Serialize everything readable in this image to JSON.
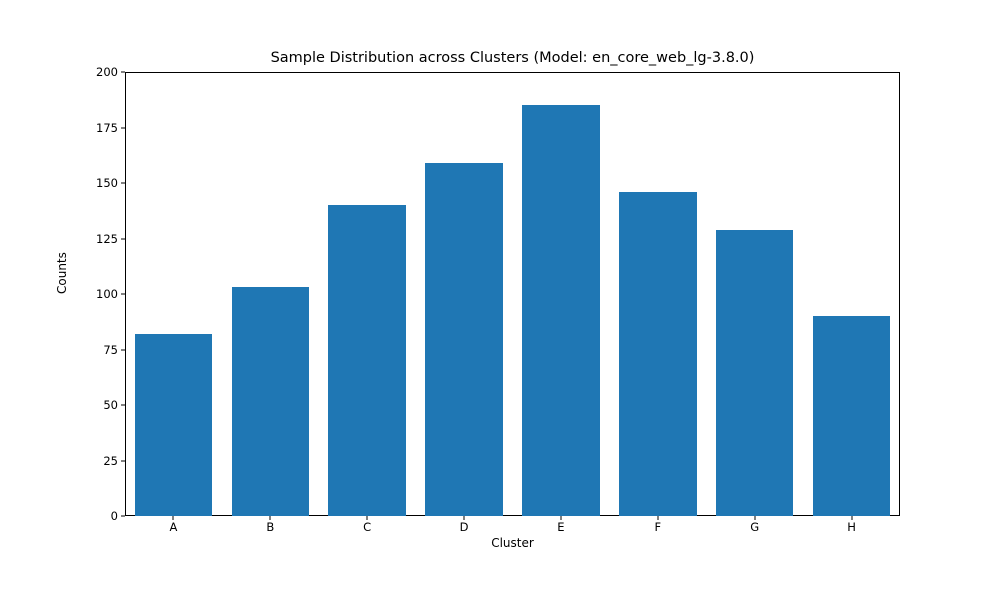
{
  "chart_data": {
    "type": "bar",
    "title": "Sample Distribution across Clusters (Model: en_core_web_lg-3.8.0)",
    "xlabel": "Cluster",
    "ylabel": "Counts",
    "categories": [
      "A",
      "B",
      "C",
      "D",
      "E",
      "F",
      "G",
      "H"
    ],
    "values": [
      82,
      103,
      140,
      159,
      185,
      146,
      129,
      90
    ],
    "ylim": [
      0,
      200
    ],
    "yticks": [
      0,
      25,
      50,
      75,
      100,
      125,
      150,
      175,
      200
    ],
    "bar_color": "#1f77b4"
  }
}
